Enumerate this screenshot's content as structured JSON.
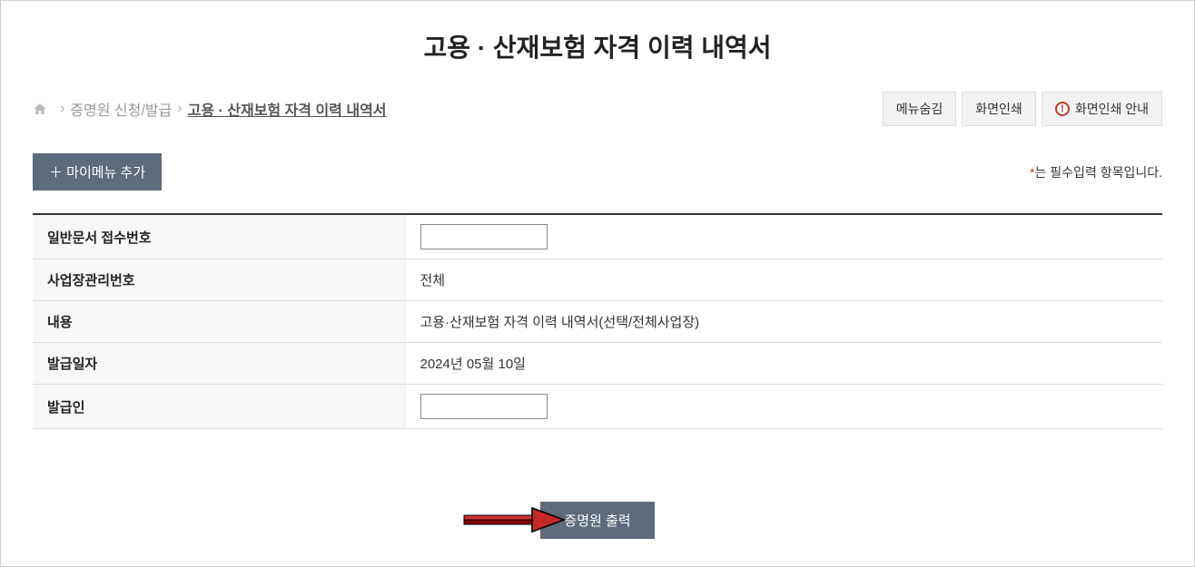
{
  "title": "고용 · 산재보험 자격 이력 내역서",
  "breadcrumb": {
    "item1": "증명원 신청/발급",
    "current": "고용 · 산재보험 자격 이력 내역서"
  },
  "header_buttons": {
    "hide_menu": "메뉴숨김",
    "print_screen": "화면인쇄",
    "print_guide": "화면인쇄 안내"
  },
  "add_my_menu": "＋ 마이메뉴 추가",
  "required_note": {
    "star": "*",
    "text": "는 필수입력 항목입니다."
  },
  "form": {
    "doc_number_label": "일반문서 접수번호",
    "doc_number_value": "",
    "workplace_label": "사업장관리번호",
    "workplace_value": "전체",
    "content_label": "내용",
    "content_value": "고용·산재보험 자격 이력 내역서(선택/전체사업장)",
    "issue_date_label": "발급일자",
    "issue_date_value": "2024년 05월 10일",
    "issuer_label": "발급인",
    "issuer_value": ""
  },
  "print_button": "증명원 출력"
}
